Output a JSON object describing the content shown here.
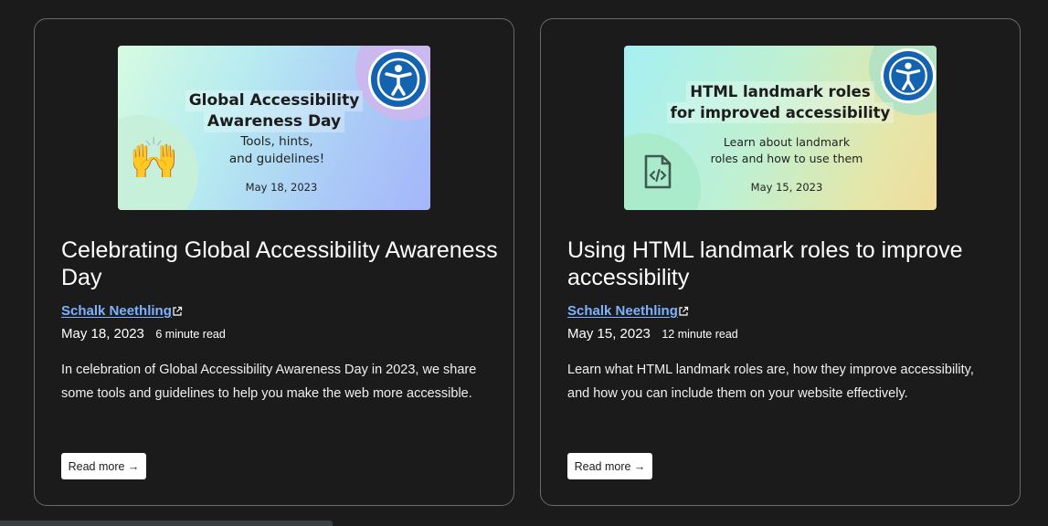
{
  "colors": {
    "background": "#1b1b1b",
    "card_border": "#6a6a6a",
    "author_link": "#7eb2ff",
    "badge_blue": "#1463b0",
    "button_bg": "#ffffff"
  },
  "cards": [
    {
      "thumbnail": {
        "title_line1": "Global Accessibility",
        "title_line2": "Awareness Day",
        "subtitle_line1": "Tools, hints,",
        "subtitle_line2": "and guidelines!",
        "date": "May 18, 2023",
        "badge_icon": "accessibility-icon",
        "corner_icon": "raising-hands-emoji",
        "corner_glyph": "🙌"
      },
      "title": "Celebrating Global Accessibility Awareness Day",
      "author": "Schalk Neethling",
      "author_icon": "external-link-icon",
      "date": "May 18, 2023",
      "read_time": "6 minute read",
      "excerpt": "In celebration of Global Accessibility Awareness Day in 2023, we share some tools and guidelines to help you make the web more accessible.",
      "button_label": "Read more →"
    },
    {
      "thumbnail": {
        "title_line1": "HTML landmark roles",
        "title_line2": "for improved accessibility",
        "subtitle_line1": "Learn about landmark",
        "subtitle_line2": "roles and how to use them",
        "date": "May 15, 2023",
        "badge_icon": "accessibility-icon",
        "corner_icon": "code-file-icon"
      },
      "title": "Using HTML landmark roles to improve accessibility",
      "author": "Schalk Neethling",
      "author_icon": "external-link-icon",
      "date": "May 15, 2023",
      "read_time": "12 minute read",
      "excerpt": "Learn what HTML landmark roles are, how they improve accessibility, and how you can include them on your website effectively.",
      "button_label": "Read more →"
    }
  ]
}
